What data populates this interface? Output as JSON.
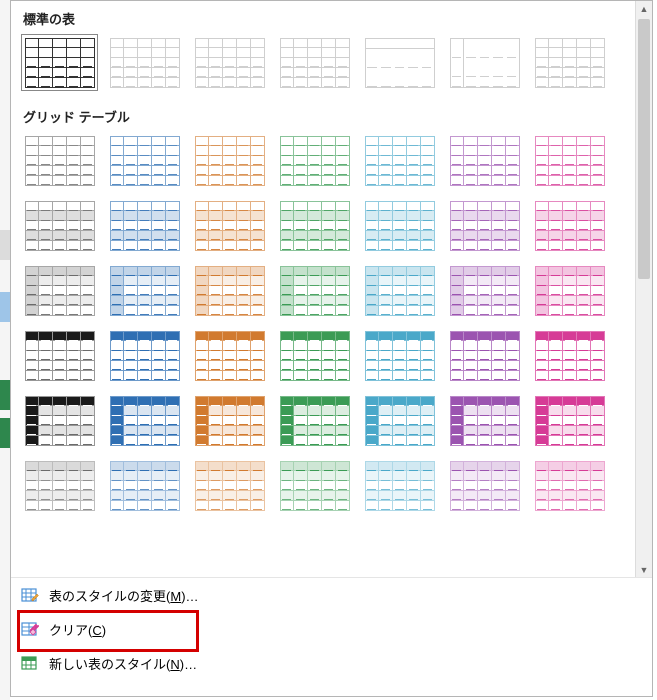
{
  "sections": {
    "plain_tables": "標準の表",
    "grid_tables": "グリッド テーブル"
  },
  "footer": {
    "modify": {
      "prefix": "表のスタイルの変更(",
      "key": "M",
      "suffix": ")…"
    },
    "clear": {
      "prefix": "クリア(",
      "key": "C",
      "suffix": ")"
    },
    "newstyle": {
      "prefix": "新しい表のスタイル(",
      "key": "N",
      "suffix": ")…"
    }
  },
  "palette": [
    "#595959",
    "#6f6f6f",
    "#2f6fb3",
    "#d17a2f",
    "#3b9b55",
    "#4aa8c9",
    "#9b54b0",
    "#d63b96"
  ],
  "plain_styles": [
    {
      "border": "#333333",
      "dash": "#333333",
      "header": null,
      "body": "#ffffff"
    },
    {
      "border": "#c9c9c9",
      "dash": "#c9c9c9",
      "header": null,
      "body": "#ffffff"
    },
    {
      "border": "#c9c9c9",
      "dash": "#c9c9c9",
      "header": null,
      "body": "#ffffff"
    },
    {
      "border": "#c9c9c9",
      "dash": "#c9c9c9",
      "header": null,
      "body": "#ffffff"
    },
    {
      "border": "#333333",
      "dash": "#c9c9c9",
      "header": null,
      "body": "#ffffff",
      "topbottom": true
    },
    {
      "border": "#c9c9c9",
      "dash": "#c9c9c9",
      "header": null,
      "body": "#ffffff",
      "midline": true
    },
    {
      "border": "#c9c9c9",
      "dash": "#c9c9c9",
      "header": null,
      "body": "#ffffff"
    }
  ],
  "grid_rows": [
    {
      "type": "light1"
    },
    {
      "type": "light2_banded"
    },
    {
      "type": "light3_firstcol"
    },
    {
      "type": "medium1_header"
    },
    {
      "type": "medium2_headerband"
    },
    {
      "type": "medium3_light"
    }
  ]
}
